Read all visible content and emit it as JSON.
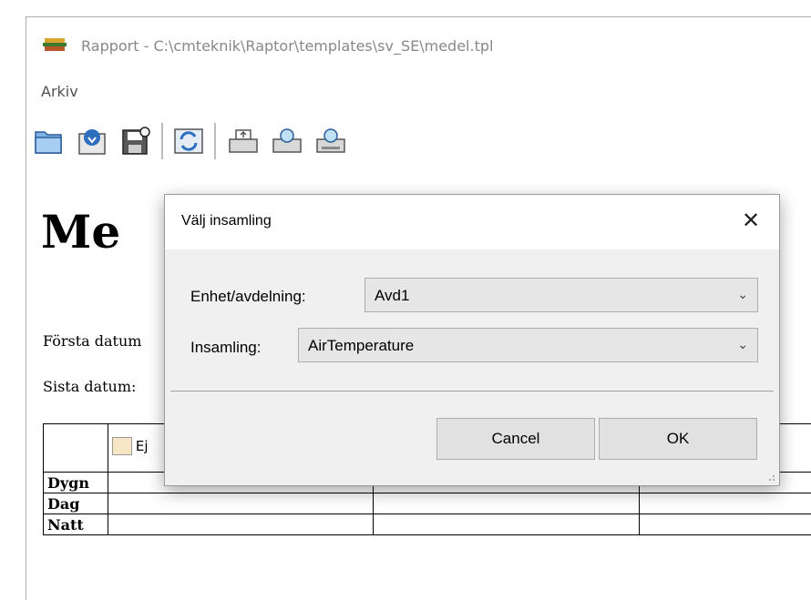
{
  "window": {
    "title": "Rapport - C:\\cmteknik\\Raptor\\templates\\sv_SE\\medel.tpl",
    "menu": [
      "Arkiv"
    ]
  },
  "toolbar": {
    "buttons": [
      "open-folder-icon",
      "import-icon",
      "save-settings-icon",
      "refresh-icon",
      "print-icon",
      "print-preview-icon",
      "print-setup-icon"
    ]
  },
  "document": {
    "heading_partial": "Me",
    "first_date_label_partial": "Första datum",
    "last_date_label_partial": "Sista datum:",
    "table_button_partial": "Ej",
    "rows": [
      "Dygn",
      "Dag",
      "Natt"
    ]
  },
  "dialog": {
    "title": "Välj insamling",
    "close_glyph": "✕",
    "unit_label": "Enhet/avdelning:",
    "unit_value": "Avd1",
    "collection_label": "Insamling:",
    "collection_value": "AirTemperature",
    "cancel_label": "Cancel",
    "ok_label": "OK"
  }
}
